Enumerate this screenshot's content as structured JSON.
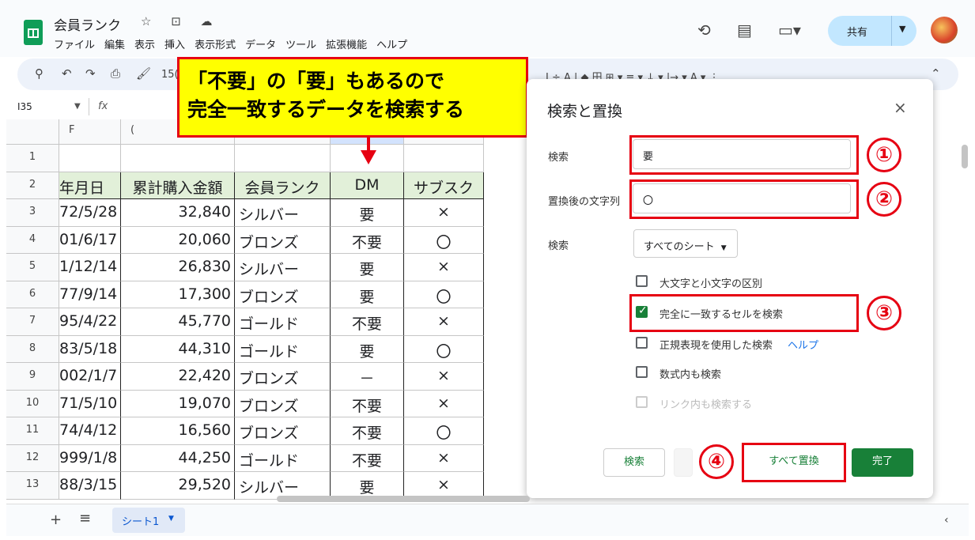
{
  "header": {
    "title": "会員ランク",
    "title_icons": "☆ ⊡ ☁",
    "menus": [
      "ファイル",
      "編集",
      "表示",
      "挿入",
      "表示形式",
      "データ",
      "ツール",
      "拡張機能",
      "ヘルプ"
    ],
    "share_label": "共有"
  },
  "toolbar": {
    "zoom": "15(",
    "right_icons": "I  ÷  A  |  ◆  田  ⊞ ▾  ≡ ▾  ↓ ▾  |→ ▾  A ▾  ⋮"
  },
  "formula": {
    "cell_ref": "I35",
    "fx": "fx"
  },
  "columns": [
    "F",
    "(",
    "",
    "",
    ""
  ],
  "row_numbers": [
    "1",
    "2",
    "3",
    "4",
    "5",
    "6",
    "7",
    "8",
    "9",
    "10",
    "11",
    "12",
    "13"
  ],
  "table": {
    "headers": [
      "年月日",
      "累計購入金額",
      "会員ランク",
      "DM",
      "サブスク"
    ],
    "rows": [
      [
        "72/5/28",
        "32,840",
        "シルバー",
        "要",
        "×"
      ],
      [
        "01/6/17",
        "20,060",
        "ブロンズ",
        "不要",
        "〇"
      ],
      [
        "1/12/14",
        "26,830",
        "シルバー",
        "要",
        "×"
      ],
      [
        "77/9/14",
        "17,300",
        "ブロンズ",
        "要",
        "〇"
      ],
      [
        "95/4/22",
        "45,770",
        "ゴールド",
        "不要",
        "×"
      ],
      [
        "83/5/18",
        "44,310",
        "ゴールド",
        "要",
        "〇"
      ],
      [
        "002/1/7",
        "22,420",
        "ブロンズ",
        "－",
        "×"
      ],
      [
        "71/5/10",
        "19,070",
        "ブロンズ",
        "不要",
        "×"
      ],
      [
        "74/4/12",
        "16,560",
        "ブロンズ",
        "不要",
        "〇"
      ],
      [
        "999/1/8",
        "44,250",
        "ゴールド",
        "不要",
        "×"
      ],
      [
        "88/3/15",
        "29,520",
        "シルバー",
        "要",
        "×"
      ]
    ]
  },
  "callout": {
    "line1": "「不要」の「要」もあるので",
    "line2": "完全一致するデータを検索する"
  },
  "dialog": {
    "title": "検索と置換",
    "close": "×",
    "find_label": "検索",
    "find_value": "要",
    "replace_label": "置換後の文字列",
    "replace_value": "〇",
    "scope_label": "検索",
    "scope_value": "すべてのシート",
    "options": [
      {
        "label": "大文字と小文字の区別",
        "checked": false
      },
      {
        "label": "完全に一致するセルを検索",
        "checked": true
      },
      {
        "label": "正規表現を使用した検索",
        "checked": false
      },
      {
        "label": "数式内も検索",
        "checked": false
      },
      {
        "label": "リンク内も検索する",
        "checked": false
      }
    ],
    "help_link": "ヘルプ",
    "find_button": "検索",
    "replace_all_button": "すべて置換",
    "done_button": "完了"
  },
  "badges": [
    "①",
    "②",
    "③",
    "④"
  ],
  "bottom": {
    "sheet_tab": "シート1"
  },
  "colors": {
    "accent_red": "#e60012",
    "highlight_yellow": "#ffff00",
    "green": "#188038",
    "header_fill": "#e2f0d9"
  }
}
